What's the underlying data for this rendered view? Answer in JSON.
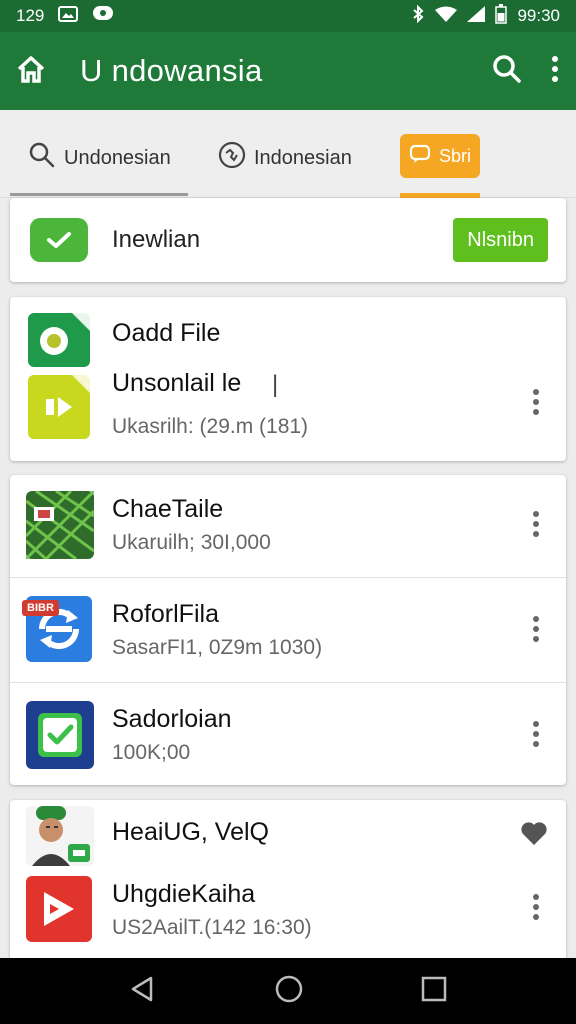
{
  "status_bar": {
    "left_time": "129",
    "right_time": "99:30"
  },
  "app_bar": {
    "title": "U ndowansia"
  },
  "tabs": [
    {
      "label": "Undonesian"
    },
    {
      "label": "Indonesian"
    },
    {
      "label": "Sbri"
    }
  ],
  "banner": {
    "label": "Inewlian",
    "button_label": "Nlsnibn"
  },
  "cards": [
    {
      "rows": [
        {
          "title": "Oadd File"
        },
        {
          "title": "Unsonlail le",
          "subtitle": "Ukasrilh: (29.m (181)"
        }
      ]
    },
    {
      "rows": [
        {
          "title": "ChaeTaile",
          "subtitle": "Ukaruilh; 30I,000"
        },
        {
          "title": "RoforlFila",
          "subtitle": "SasarFI1, 0Z9m 1030)",
          "icon_badge": "BIBR"
        },
        {
          "title": "Sadorloian",
          "subtitle": "100K;00"
        }
      ]
    },
    {
      "rows": [
        {
          "title": "HeaiUG, VelQ"
        },
        {
          "title": "UhgdieKaiha",
          "subtitle": "US2AailT.(142 16:30)"
        }
      ]
    }
  ],
  "colors": {
    "app_bar": "#1f7a3a",
    "status_bar": "#1b6b33",
    "accent_orange": "#f5a623",
    "accent_green": "#5fbf1f"
  }
}
